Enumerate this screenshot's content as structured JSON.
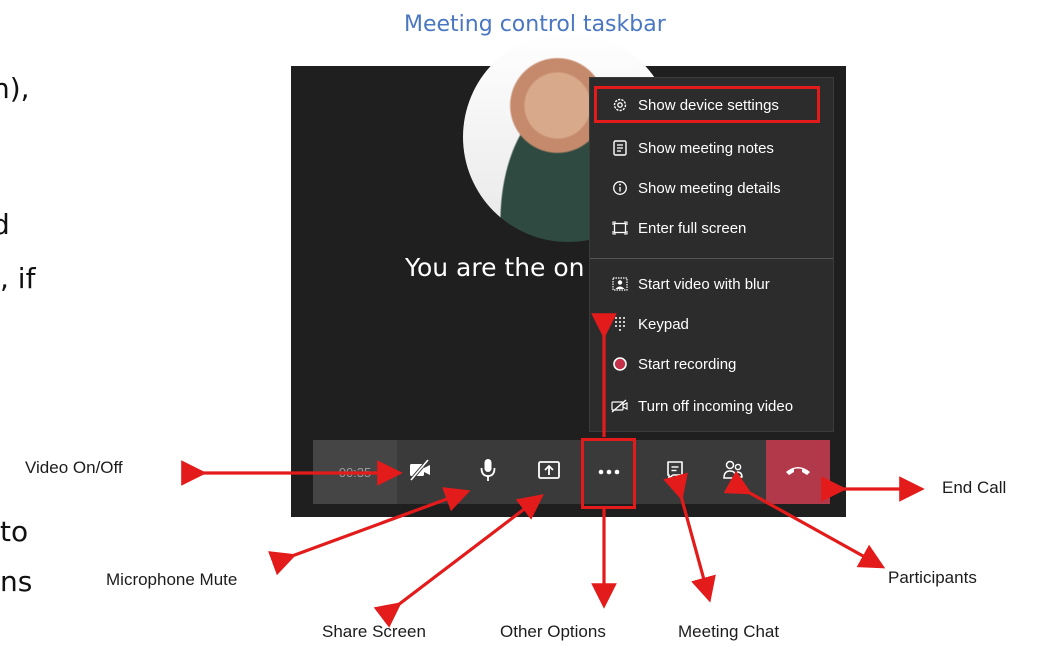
{
  "page_title": "Meeting control taskbar",
  "slide_fragments": [
    "n),",
    "d",
    ", if",
    "to",
    "ns"
  ],
  "meeting": {
    "center_message": "You are the on",
    "timer": "00:35",
    "menu": {
      "items": [
        {
          "label": "Show device settings",
          "icon": "gear-icon"
        },
        {
          "label": "Show meeting notes",
          "icon": "notes-icon"
        },
        {
          "label": "Show meeting details",
          "icon": "info-icon"
        },
        {
          "label": "Enter full screen",
          "icon": "fullscreen-icon"
        },
        {
          "label": "Start video with blur",
          "icon": "blur-icon"
        },
        {
          "label": "Keypad",
          "icon": "keypad-icon"
        },
        {
          "label": "Start recording",
          "icon": "record-icon"
        },
        {
          "label": "Turn off incoming video",
          "icon": "video-off-icon"
        }
      ],
      "highlighted_item": "Show device settings"
    },
    "taskbar": {
      "buttons": [
        "video-off-icon",
        "microphone-icon",
        "share-screen-icon",
        "more-options-icon",
        "chat-icon",
        "participants-icon",
        "end-call-icon"
      ],
      "end_call_color": "#b2394a"
    }
  },
  "annotations": {
    "video": "Video On/Off",
    "microphone": "Microphone Mute",
    "share": "Share Screen",
    "other": "Other Options",
    "chat": "Meeting Chat",
    "participants": "Participants",
    "end_call": "End Call"
  },
  "colors": {
    "title": "#4a77c1",
    "arrow": "#e31b1b",
    "highlight": "#e31b1b",
    "menu_bg": "#2d2c2c",
    "taskbar_bg": "#3a3a3a"
  }
}
